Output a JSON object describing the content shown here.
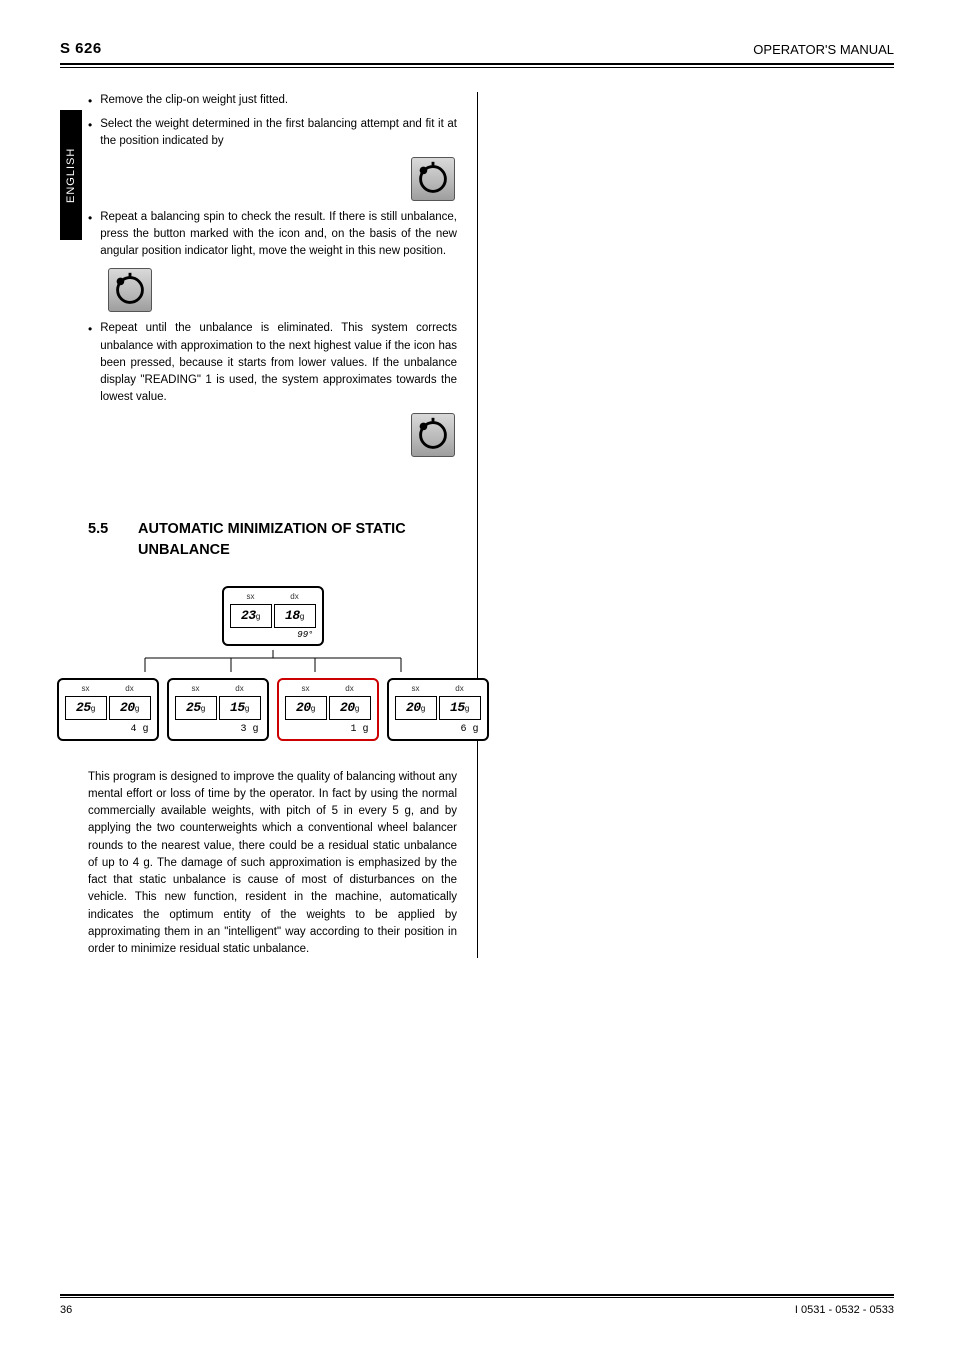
{
  "header": {
    "brand": "S 626",
    "manual_title": "OPERATOR'S MANUAL"
  },
  "side_tab": "ENGLISH",
  "bullets": [
    {
      "text": "Remove the clip-on weight just fitted."
    },
    {
      "text": "Select the weight determined in the first balancing attempt and fit it at the position indicated by "
    },
    {
      "text": "Repeat a balancing spin to check the result. If there is still unbalance, press the button marked with the icon  and, on the basis of the new angular position indicator light, move the weight in this new position.",
      "icon_after_word": true
    },
    {
      "text": "Repeat until the unbalance is eliminated. This system corrects unbalance with approximation to the next highest value if the icon  has been pressed, because it starts from lower values. If the unbalance display \"READING\" 1 is used, the system approximates towards the lowest value."
    }
  ],
  "section": {
    "number": "5.5",
    "title": "AUTOMATIC MINIMIZATION OF STATIC UNBALANCE"
  },
  "diagram": {
    "top": {
      "sx": "23",
      "dx": "18",
      "residual": "99°"
    },
    "options": [
      {
        "sx": "25",
        "dx": "20",
        "residual": "4 g",
        "selected": false
      },
      {
        "sx": "25",
        "dx": "15",
        "residual": "3 g",
        "selected": false
      },
      {
        "sx": "20",
        "dx": "20",
        "residual": "1 g",
        "selected": true
      },
      {
        "sx": "20",
        "dx": "15",
        "residual": "6 g",
        "selected": false
      }
    ],
    "unit": "g",
    "labels": {
      "sx": "sx",
      "dx": "dx"
    }
  },
  "body": "This program is designed to improve the quality of balancing without any mental effort or loss of time by the operator. In fact by using the normal commercially available weights, with pitch of 5 in every 5 g, and by applying the two counterweights which a conventional wheel balancer rounds to the nearest value, there could be a residual static unbalance of up to 4 g. The damage of such approximation is emphasized by the fact that static unbalance is cause of most of disturbances on the vehicle. This new function, resident in the machine, automatically indicates the optimum entity of the weights to be applied by approximating them in an \"intelligent\" way according to their position in order to minimize residual static unbalance.",
  "footer": {
    "page": "36",
    "doc_id": "I 0531 - 0532 - 0533"
  },
  "icons": {
    "weight_icon_name": "weight-position-icon"
  }
}
